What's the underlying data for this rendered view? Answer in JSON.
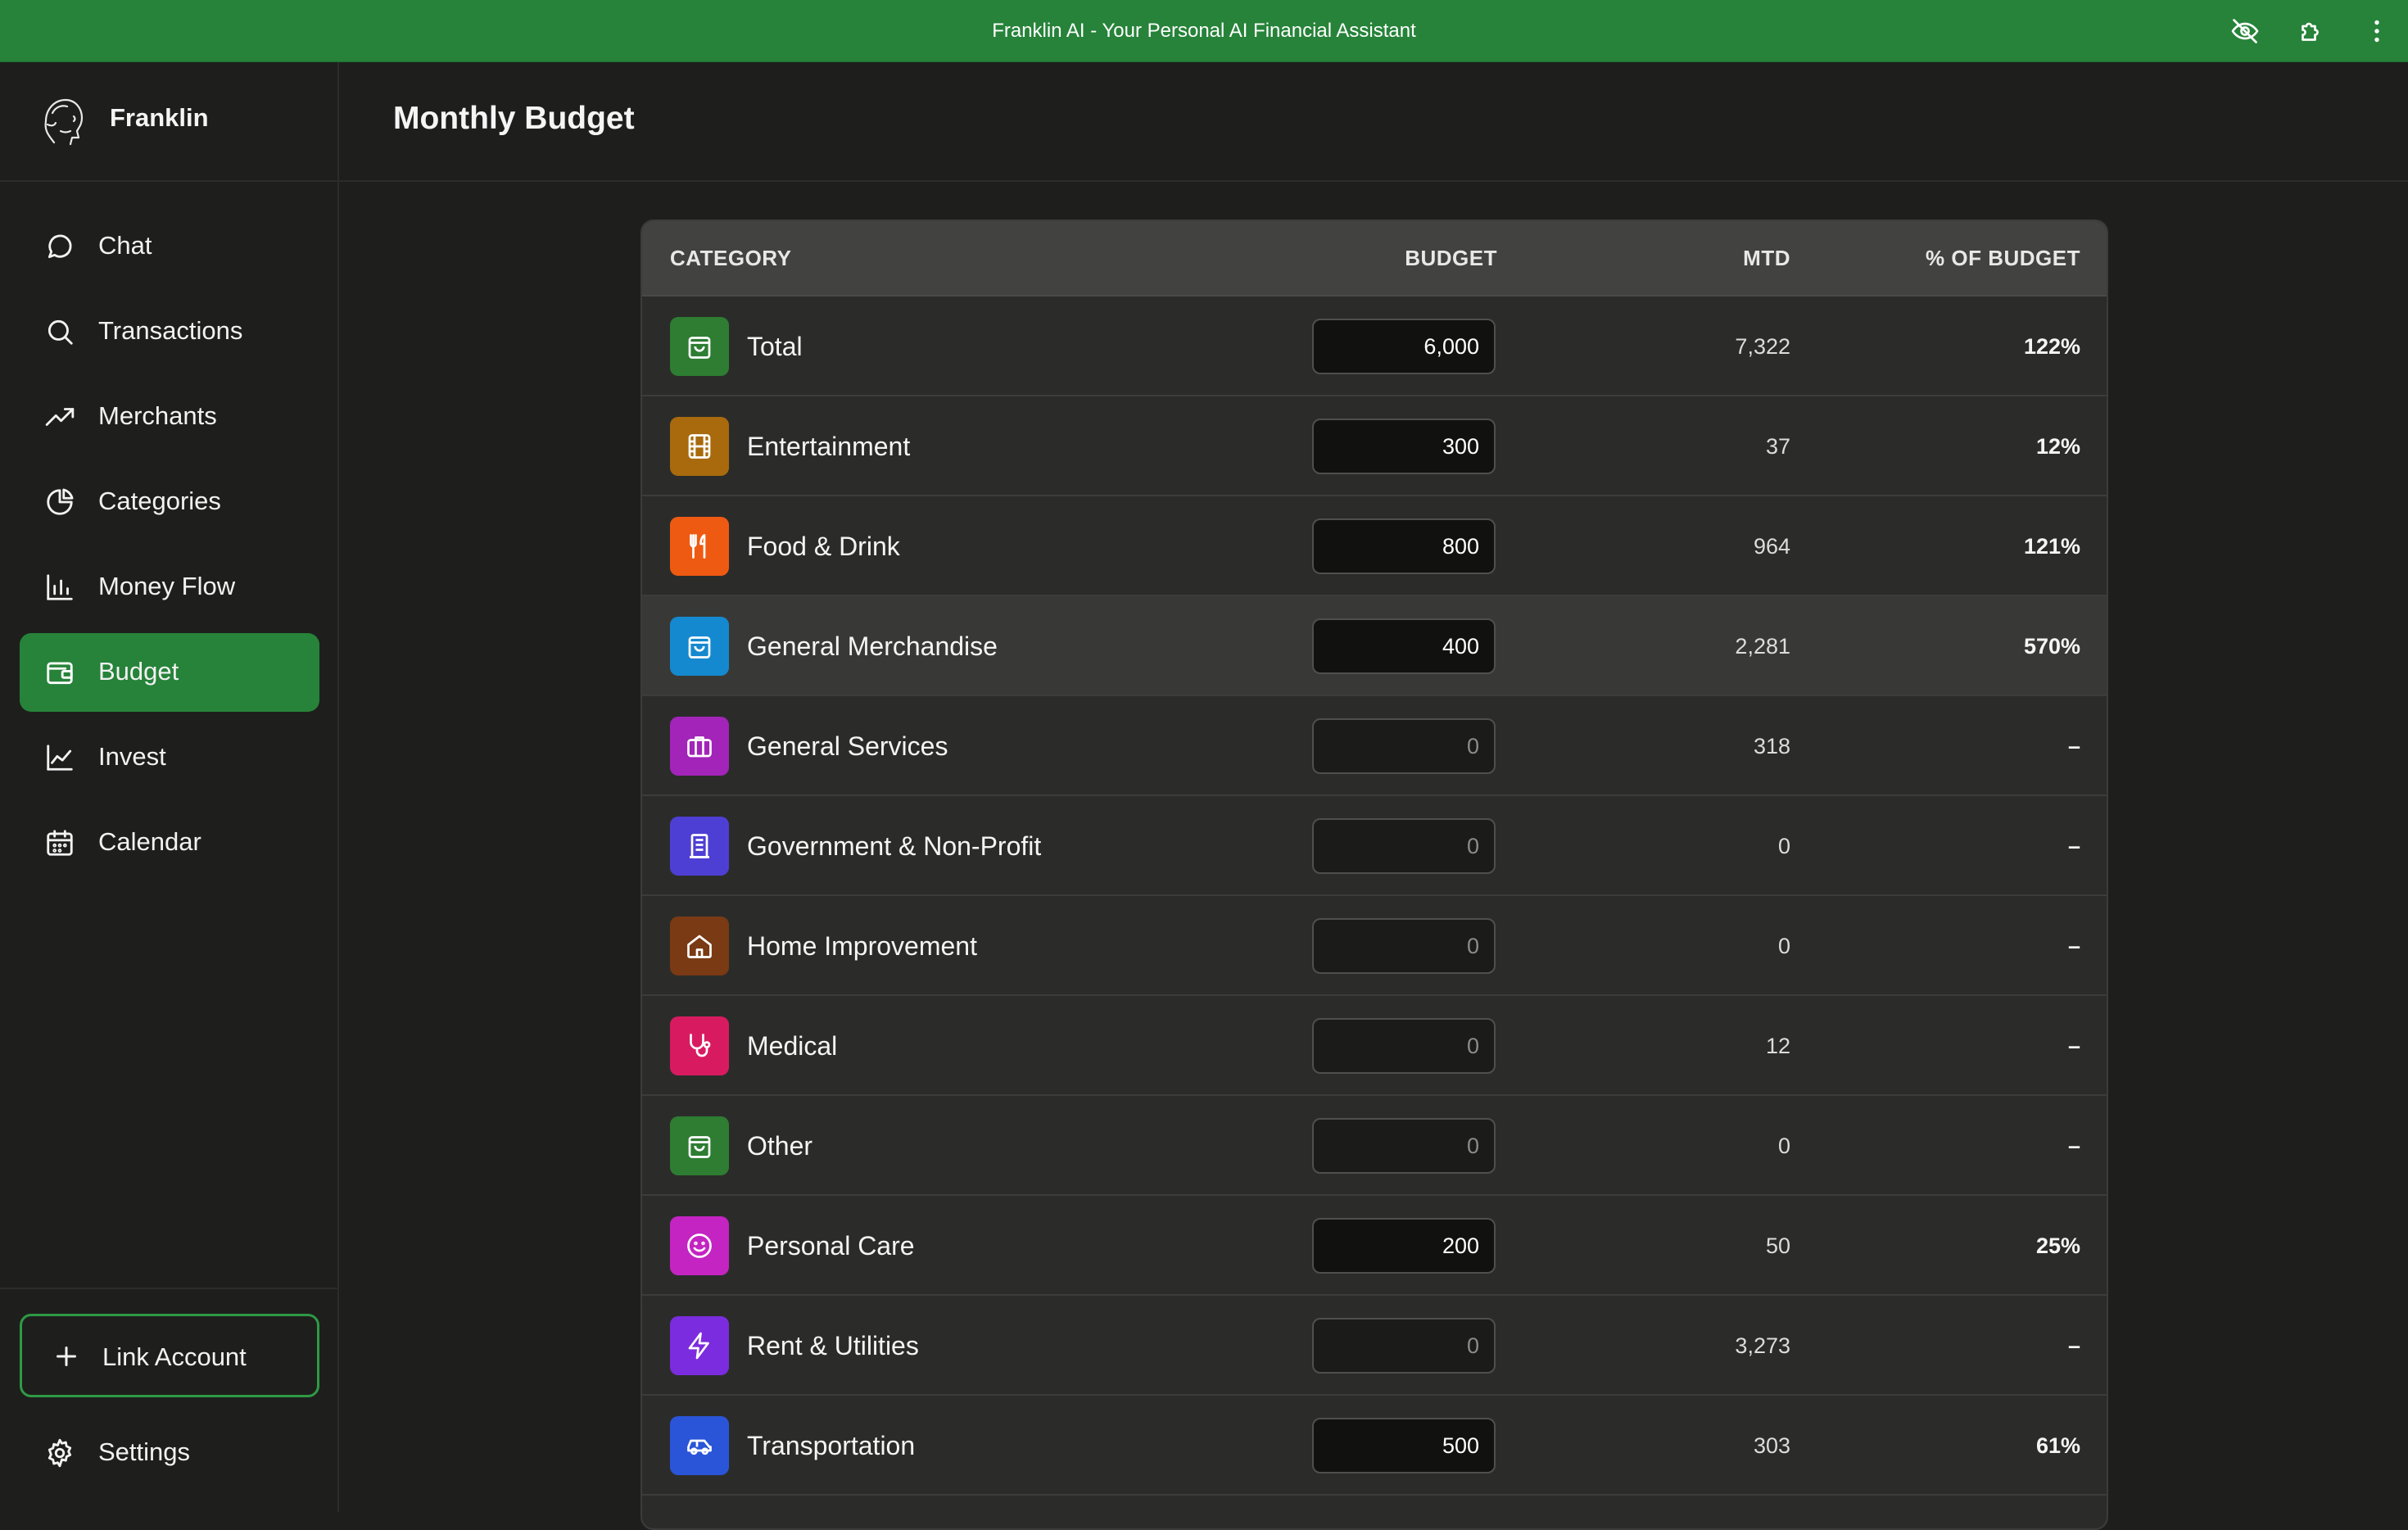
{
  "window": {
    "title": "Franklin AI - Your Personal AI Financial Assistant"
  },
  "brand": {
    "name": "Franklin"
  },
  "sidebar": {
    "items": [
      {
        "label": "Chat",
        "icon": "chat-bubble-icon"
      },
      {
        "label": "Transactions",
        "icon": "search-icon"
      },
      {
        "label": "Merchants",
        "icon": "trending-up-icon"
      },
      {
        "label": "Categories",
        "icon": "pie-chart-icon"
      },
      {
        "label": "Money Flow",
        "icon": "bar-chart-icon"
      },
      {
        "label": "Budget",
        "icon": "wallet-icon",
        "active": true
      },
      {
        "label": "Invest",
        "icon": "line-chart-icon"
      },
      {
        "label": "Calendar",
        "icon": "calendar-icon"
      }
    ],
    "link_account": "Link Account",
    "settings": "Settings"
  },
  "page": {
    "title": "Monthly Budget"
  },
  "table": {
    "headers": {
      "category": "CATEGORY",
      "budget": "BUDGET",
      "mtd": "MTD",
      "pct": "% OF BUDGET"
    },
    "rows": [
      {
        "category": "Total",
        "budget": "6,000",
        "mtd": "7,322",
        "pct": "122%",
        "color": "#2e7d32",
        "icon": "shopping-bag-icon"
      },
      {
        "category": "Entertainment",
        "budget": "300",
        "mtd": "37",
        "pct": "12%",
        "color": "#a86a0c",
        "icon": "film-icon"
      },
      {
        "category": "Food & Drink",
        "budget": "800",
        "mtd": "964",
        "pct": "121%",
        "color": "#ef5a12",
        "icon": "utensils-icon"
      },
      {
        "category": "General Merchandise",
        "budget": "400",
        "mtd": "2,281",
        "pct": "570%",
        "color": "#1589cf",
        "icon": "shopping-bag-icon"
      },
      {
        "category": "General Services",
        "budget": "0",
        "mtd": "318",
        "pct": "–",
        "color": "#a224b8",
        "icon": "briefcase-icon"
      },
      {
        "category": "Government & Non-Profit",
        "budget": "0",
        "mtd": "0",
        "pct": "–",
        "color": "#4e3fd4",
        "icon": "building-icon"
      },
      {
        "category": "Home Improvement",
        "budget": "0",
        "mtd": "0",
        "pct": "–",
        "color": "#7a3a14",
        "icon": "home-icon"
      },
      {
        "category": "Medical",
        "budget": "0",
        "mtd": "12",
        "pct": "–",
        "color": "#d81b60",
        "icon": "stethoscope-icon"
      },
      {
        "category": "Other",
        "budget": "0",
        "mtd": "0",
        "pct": "–",
        "color": "#2e7d32",
        "icon": "shopping-bag-icon"
      },
      {
        "category": "Personal Care",
        "budget": "200",
        "mtd": "50",
        "pct": "25%",
        "color": "#c424c2",
        "icon": "smile-icon"
      },
      {
        "category": "Rent & Utilities",
        "budget": "0",
        "mtd": "3,273",
        "pct": "–",
        "color": "#7b2cde",
        "icon": "lightning-icon"
      },
      {
        "category": "Transportation",
        "budget": "500",
        "mtd": "303",
        "pct": "61%",
        "color": "#2a55d8",
        "icon": "car-icon"
      }
    ]
  }
}
